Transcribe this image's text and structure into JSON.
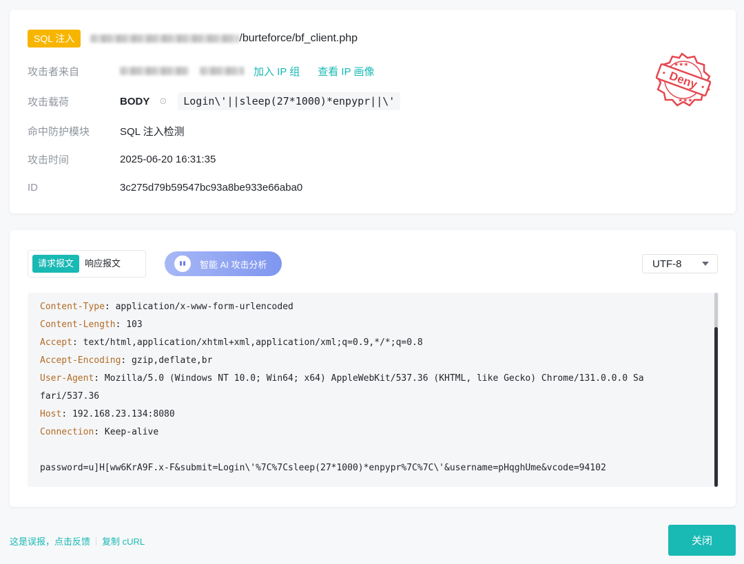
{
  "attack": {
    "type_tag": "SQL 注入",
    "url_path": "/burteforce/bf_client.php",
    "rows": {
      "source_label": "攻击者来自",
      "add_ip_group": "加入 IP 组",
      "view_ip_profile": "查看 IP 画像",
      "payload_label": "攻击载荷",
      "payload_location": "BODY",
      "payload_value": "Login\\'||sleep(27*1000)*enpypr||\\'",
      "module_label": "命中防护模块",
      "module_value": "SQL 注入检测",
      "time_label": "攻击时间",
      "time_value": "2025-06-20 16:31:35",
      "id_label": "ID",
      "id_value": "3c275d79b59547bc93a8be933e66aba0"
    },
    "stamp_text": "Deny",
    "stamp_color": "#e5474f"
  },
  "packet": {
    "tabs": [
      "请求报文",
      "响应报文"
    ],
    "ai_button": "智能 AI 攻击分析",
    "encoding": "UTF-8",
    "headers": [
      {
        "key": "Content-Type",
        "value": ": application/x-www-form-urlencoded"
      },
      {
        "key": "Content-Length",
        "value": ": 103"
      },
      {
        "key": "Accept",
        "value": ": text/html,application/xhtml+xml,application/xml;q=0.9,*/*;q=0.8"
      },
      {
        "key": "Accept-Encoding",
        "value": ": gzip,deflate,br"
      },
      {
        "key": "User-Agent",
        "value": ": Mozilla/5.0 (Windows NT 10.0; Win64; x64) AppleWebKit/537.36 (KHTML, like Gecko) Chrome/131.0.0.0 Sa"
      },
      {
        "key": "",
        "value": "fari/537.36"
      },
      {
        "key": "Host",
        "value": ": 192.168.23.134:8080"
      },
      {
        "key": "Connection",
        "value": ": Keep-alive"
      }
    ],
    "body": "password=u]H[ww6KrA9F.x-F&submit=Login\\'%7C%7Csleep(27*1000)*enpypr%7C%7C\\'&username=pHqghUme&vcode=94102"
  },
  "footer": {
    "false_positive": "这是误报，点击反馈",
    "copy_curl": "复制 cURL",
    "close": "关闭"
  },
  "colors": {
    "accent": "#19b9b4",
    "tag": "#f7b500",
    "header_key": "#b26b26"
  }
}
